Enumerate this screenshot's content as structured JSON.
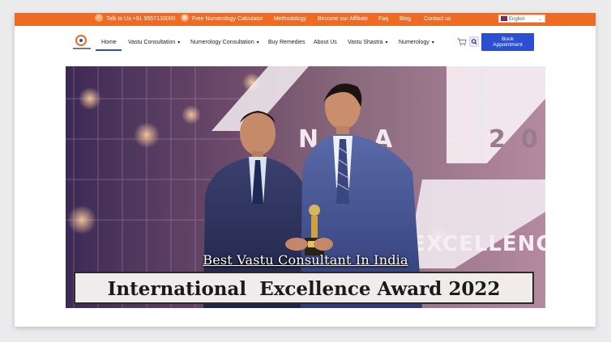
{
  "topbar": {
    "phone_text": "Talk to Us +91 9557133000",
    "links": [
      "Free Numerology Calculator",
      "Methodology",
      "Become our Affiliate",
      "Faq",
      "Blog",
      "Contact us"
    ],
    "language": "English"
  },
  "nav": {
    "items": [
      {
        "label": "Home",
        "dropdown": false,
        "active": true
      },
      {
        "label": "Vastu Consultation",
        "dropdown": true
      },
      {
        "label": "Numerology Consultation",
        "dropdown": true
      },
      {
        "label": "Buy Remedies",
        "dropdown": false
      },
      {
        "label": "About Us",
        "dropdown": false
      },
      {
        "label": "Vastu Shastra",
        "dropdown": true
      },
      {
        "label": "Numerology",
        "dropdown": true
      }
    ],
    "book_button": {
      "line1": "Book",
      "line2": "Appointment"
    }
  },
  "hero": {
    "caption_top": "Best Vastu Consultant In India",
    "caption_bottom": "International  Excellence Award 2022",
    "backdrop_letters": [
      "N",
      "A",
      "-",
      "2",
      "0"
    ],
    "backdrop_word": "EXCELLENC"
  },
  "colors": {
    "topbar": "#ef6a23",
    "accent": "#2b4fd1"
  },
  "icons": [
    "phone-icon",
    "calculator-icon",
    "flag-icon",
    "chevron-down-icon",
    "cart-icon",
    "search-icon"
  ]
}
